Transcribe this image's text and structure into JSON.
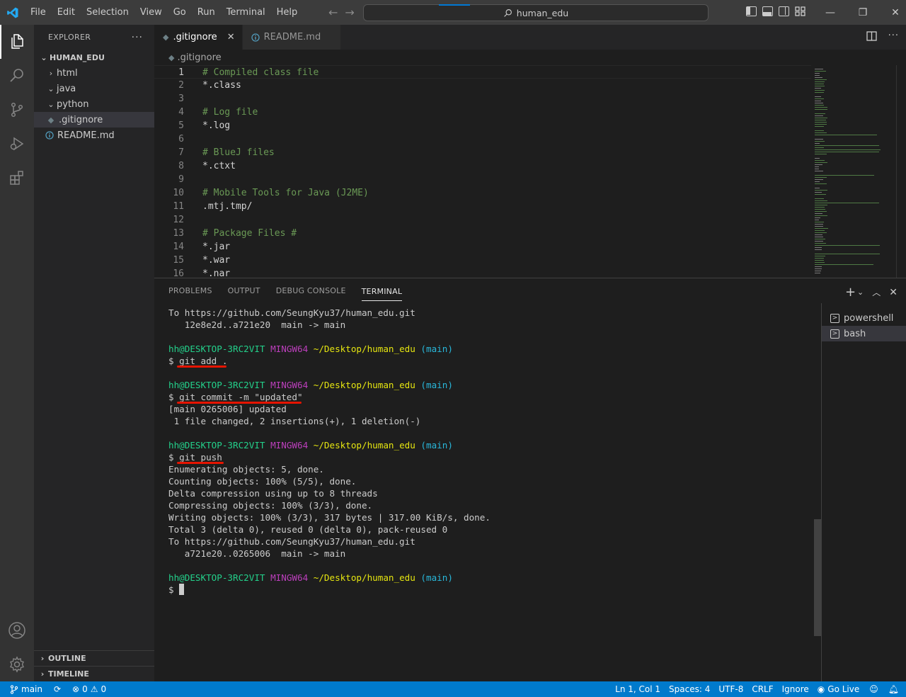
{
  "menu": [
    "File",
    "Edit",
    "Selection",
    "View",
    "Go",
    "Run",
    "Terminal",
    "Help"
  ],
  "search": {
    "label": "human_edu"
  },
  "explorer": {
    "title": "EXPLORER",
    "root": "HUMAN_EDU",
    "items": [
      {
        "label": "html"
      },
      {
        "label": "java"
      },
      {
        "label": "python"
      },
      {
        "label": ".gitignore"
      },
      {
        "label": "README.md"
      }
    ],
    "outline": "OUTLINE",
    "timeline": "TIMELINE"
  },
  "tabs": [
    {
      "label": ".gitignore"
    },
    {
      "label": "README.md"
    }
  ],
  "breadcrumb": ".gitignore",
  "code": [
    {
      "n": "1",
      "t": "# Compiled class file",
      "c": true
    },
    {
      "n": "2",
      "t": "*.class",
      "c": false
    },
    {
      "n": "3",
      "t": "",
      "c": false
    },
    {
      "n": "4",
      "t": "# Log file",
      "c": true
    },
    {
      "n": "5",
      "t": "*.log",
      "c": false
    },
    {
      "n": "6",
      "t": "",
      "c": false
    },
    {
      "n": "7",
      "t": "# BlueJ files",
      "c": true
    },
    {
      "n": "8",
      "t": "*.ctxt",
      "c": false
    },
    {
      "n": "9",
      "t": "",
      "c": false
    },
    {
      "n": "10",
      "t": "# Mobile Tools for Java (J2ME)",
      "c": true
    },
    {
      "n": "11",
      "t": ".mtj.tmp/",
      "c": false
    },
    {
      "n": "12",
      "t": "",
      "c": false
    },
    {
      "n": "13",
      "t": "# Package Files #",
      "c": true
    },
    {
      "n": "14",
      "t": "*.jar",
      "c": false
    },
    {
      "n": "15",
      "t": "*.war",
      "c": false
    },
    {
      "n": "16",
      "t": "*.nar",
      "c": false
    }
  ],
  "panel": {
    "tabs": [
      "PROBLEMS",
      "OUTPUT",
      "DEBUG CONSOLE",
      "TERMINAL"
    ],
    "terminals": [
      "powershell",
      "bash"
    ]
  },
  "terminal": {
    "prompt": {
      "user": "hh@DESKTOP-3RC2VIT",
      "sys": "MINGW64",
      "path": "~/Desktop/human_edu",
      "branch": "(main)"
    },
    "l1": "To https://github.com/SeungKyu37/human_edu.git",
    "l2": "   12e8e2d..a721e20  main -> main",
    "cmd_add": "$ git add .",
    "cmd_commit": "$ git commit -m \"updated\"",
    "out_commit_1": "[main 0265006] updated",
    "out_commit_2": " 1 file changed, 2 insertions(+), 1 deletion(-)",
    "cmd_push": "$ git push",
    "push_out": [
      "Enumerating objects: 5, done.",
      "Counting objects: 100% (5/5), done.",
      "Delta compression using up to 8 threads",
      "Compressing objects: 100% (3/3), done.",
      "Writing objects: 100% (3/3), 317 bytes | 317.00 KiB/s, done.",
      "Total 3 (delta 0), reused 0 (delta 0), pack-reused 0",
      "To https://github.com/SeungKyu37/human_edu.git",
      "   a721e20..0265006  main -> main"
    ],
    "final_prompt": "$ "
  },
  "status": {
    "branch": "main",
    "errors": "0",
    "warnings": "0",
    "position": "Ln 1, Col 1",
    "spaces": "Spaces: 4",
    "encoding": "UTF-8",
    "eol": "CRLF",
    "language": "Ignore",
    "golive": "Go Live"
  },
  "colors": {
    "accent": "#007acc",
    "titlebar": "#3c3c3c",
    "underline_annotation": "#e51400"
  }
}
